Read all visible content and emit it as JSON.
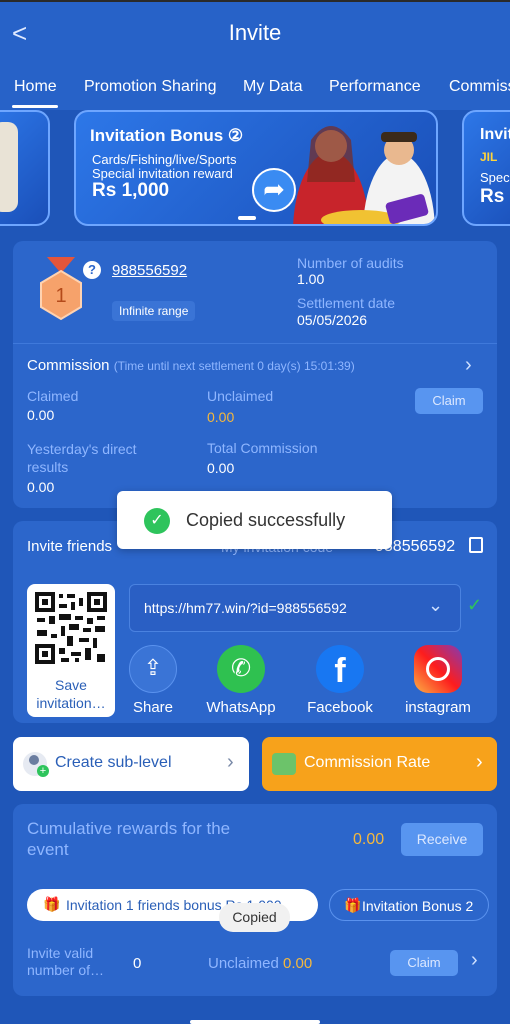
{
  "header": {
    "back": "<",
    "title": "Invite"
  },
  "tabs": [
    "Home",
    "Promotion Sharing",
    "My Data",
    "Performance",
    "Commiss"
  ],
  "banner": {
    "title": "Invitation Bonus ②",
    "line1": "Cards/Fishing/live/Sports",
    "line2": "Special invitation reward",
    "reward": "Rs 1,000",
    "right_title": "Invit",
    "right_tag": "JIL",
    "right_line": "Spec",
    "right_reward": "Rs"
  },
  "account": {
    "rank": "1",
    "help": "?",
    "id": "988556592",
    "range": "Infinite range",
    "audits_label": "Number of audits",
    "audits_value": "1.00",
    "settle_label": "Settlement date",
    "settle_value": "05/05/2026"
  },
  "commission": {
    "label": "Commission",
    "timer": "(Time until next settlement 0 day(s) 15:01:39)",
    "claimed_label": "Claimed",
    "claimed_value": "0.00",
    "unclaimed_label": "Unclaimed",
    "unclaimed_value": "0.00",
    "claim": "Claim",
    "yesterday_label1": "Yesterday's direct",
    "yesterday_label2": "results",
    "yesterday_value": "0.00",
    "total_label": "Total Commission",
    "total_value": "0.00"
  },
  "toast": {
    "text": "Copied successfully"
  },
  "invite": {
    "label": "Invite friends",
    "code_label": "My invitation code",
    "code": "988556592",
    "link": "https://hm77.win/?id=988556592",
    "qr_caption": "Save invitation…",
    "share": "Share",
    "whatsapp": "WhatsApp",
    "facebook": "Facebook",
    "instagram": "instagram"
  },
  "actions": {
    "sublevel": "Create sub-level",
    "rate": "Commission Rate"
  },
  "event": {
    "title1": "Cumulative rewards for the",
    "title2": "event",
    "value": "0.00",
    "receive": "Receive",
    "bonus1": "Invitation 1 friends bonus Rs 1,000",
    "bonus2": "Invitation Bonus 2",
    "copied": "Copied",
    "valid_label1": "Invite valid",
    "valid_label2": "number of…",
    "valid_value": "0",
    "unclaimed_label": "Unclaimed",
    "unclaimed_value": "0.00",
    "claim": "Claim"
  },
  "colors": {
    "accent": "#f7a21b",
    "yellow": "#f5b83d",
    "green": "#2ec45c"
  }
}
